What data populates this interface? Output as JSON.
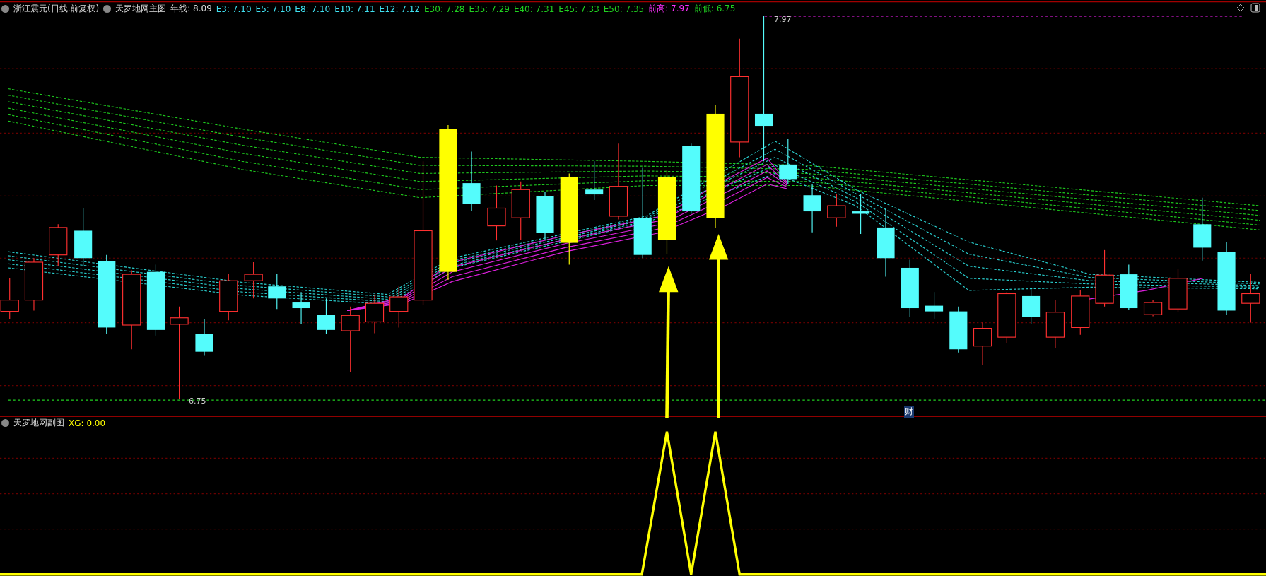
{
  "main_panel": {
    "stock": "浙江震元(日线.前复权)",
    "indicator": "天罗地网主图",
    "readings": [
      {
        "text": "年线: 8.09",
        "color": "#e0e0e0"
      },
      {
        "text": "E3: 7.10",
        "color": "#40e0f0"
      },
      {
        "text": "E5: 7.10",
        "color": "#40e0f0"
      },
      {
        "text": "E8: 7.10",
        "color": "#40e0f0"
      },
      {
        "text": "E10: 7.11",
        "color": "#40e0f0"
      },
      {
        "text": "E12: 7.12",
        "color": "#40e0f0"
      },
      {
        "text": "E30: 7.28",
        "color": "#20d020"
      },
      {
        "text": "E35: 7.29",
        "color": "#20d020"
      },
      {
        "text": "E40: 7.31",
        "color": "#20d020"
      },
      {
        "text": "E45: 7.33",
        "color": "#20d020"
      },
      {
        "text": "E50: 7.35",
        "color": "#20d020"
      },
      {
        "text": "前高: 7.97",
        "color": "#ff30ff"
      },
      {
        "text": "前低: 6.75",
        "color": "#20d020"
      }
    ],
    "high_label": "7.97",
    "low_label": "6.75",
    "marker": "财"
  },
  "sub_panel": {
    "indicator": "天罗地网副图",
    "reading": "XG: 0.00"
  }
}
